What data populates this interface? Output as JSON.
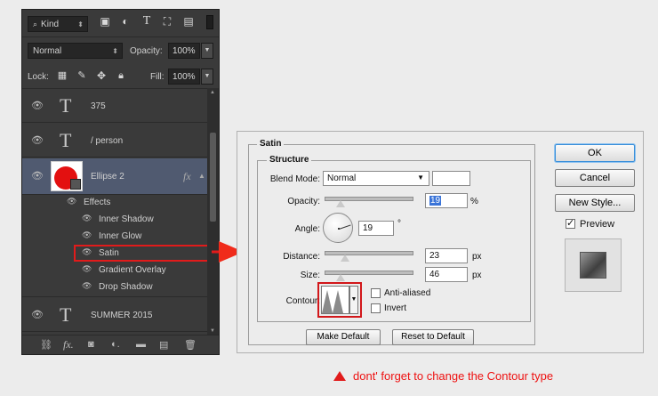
{
  "layers_panel": {
    "filter_label": "Kind",
    "blend_mode": "Normal",
    "opacity_label": "Opacity:",
    "opacity_value": "100%",
    "lock_label": "Lock:",
    "fill_label": "Fill:",
    "fill_value": "100%",
    "layers": [
      {
        "type": "text",
        "name": "375"
      },
      {
        "type": "text",
        "name": "/ person"
      },
      {
        "type": "shape",
        "name": "Ellipse 2",
        "fx": "fx"
      }
    ],
    "effects_label": "Effects",
    "effects": [
      "Inner Shadow",
      "Inner Glow",
      "Satin",
      "Gradient Overlay",
      "Drop Shadow"
    ],
    "last_layer": {
      "type": "text",
      "name": "SUMMER 2015"
    },
    "icons": [
      "search-icon",
      "image-filter-icon",
      "adjustment-filter-icon",
      "type-filter-icon",
      "shape-filter-icon",
      "smart-object-filter-icon",
      "link-icon",
      "fx-icon",
      "mask-icon",
      "adjustment-icon",
      "folder-icon",
      "new-layer-icon",
      "trash-icon"
    ]
  },
  "dialog": {
    "title": "Satin",
    "group": "Structure",
    "blend_mode_label": "Blend Mode:",
    "blend_mode_value": "Normal",
    "opacity_label": "Opacity:",
    "opacity_value": "19",
    "opacity_unit": "%",
    "angle_label": "Angle:",
    "angle_value": "19",
    "angle_unit": "°",
    "distance_label": "Distance:",
    "distance_value": "23",
    "distance_unit": "px",
    "size_label": "Size:",
    "size_value": "46",
    "size_unit": "px",
    "contour_label": "Contour:",
    "anti_aliased_label": "Anti-aliased",
    "invert_label": "Invert",
    "make_default_label": "Make Default",
    "reset_default_label": "Reset to Default",
    "ok_label": "OK",
    "cancel_label": "Cancel",
    "new_style_label": "New Style...",
    "preview_label": "Preview",
    "preview_checked": true
  },
  "note": "dont' forget to change the Contour type",
  "colors": {
    "accent_red": "#e11b1b",
    "panel_bg": "#3a3a3a",
    "selected_layer": "#505a70"
  }
}
